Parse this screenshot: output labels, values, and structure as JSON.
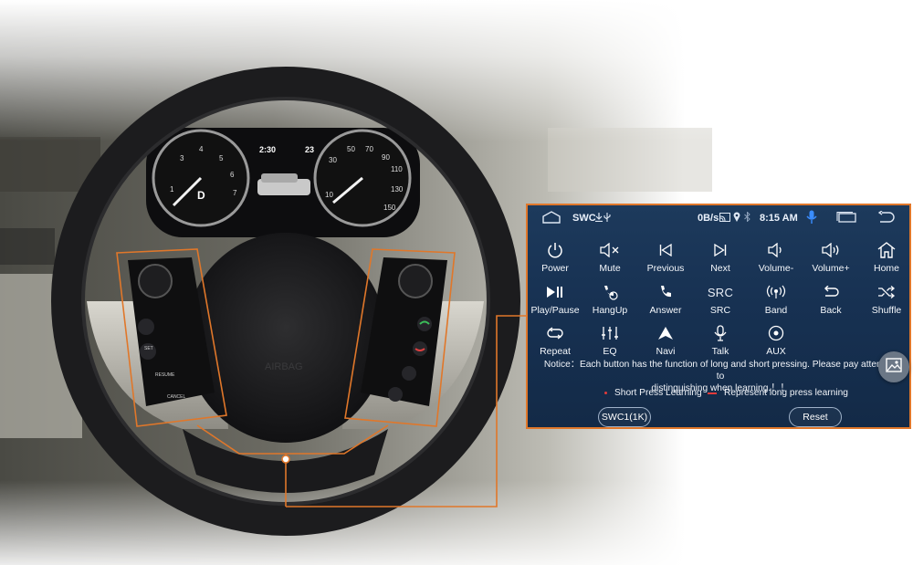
{
  "status_bar": {
    "app_name": "SWC",
    "net_speed": "0B/s",
    "time": "8:15 AM"
  },
  "buttons": [
    {
      "label": "Power",
      "icon": "power-icon"
    },
    {
      "label": "Mute",
      "icon": "mute-icon"
    },
    {
      "label": "Previous",
      "icon": "skip-previous-icon"
    },
    {
      "label": "Next",
      "icon": "skip-next-icon"
    },
    {
      "label": "Volume-",
      "icon": "volume-down-icon"
    },
    {
      "label": "Volume+",
      "icon": "volume-up-icon"
    },
    {
      "label": "Home",
      "icon": "home-icon"
    },
    {
      "label": "Play/Pause",
      "icon": "play-pause-icon"
    },
    {
      "label": "HangUp",
      "icon": "hang-up-icon"
    },
    {
      "label": "Answer",
      "icon": "phone-answer-icon"
    },
    {
      "label": "SRC",
      "icon": "src-text-icon",
      "icon_text": "SRC"
    },
    {
      "label": "Band",
      "icon": "radio-band-icon"
    },
    {
      "label": "Back",
      "icon": "back-arrow-icon"
    },
    {
      "label": "Shuffle",
      "icon": "shuffle-icon"
    },
    {
      "label": "Repeat",
      "icon": "repeat-icon"
    },
    {
      "label": "EQ",
      "icon": "equalizer-icon"
    },
    {
      "label": "Navi",
      "icon": "navigation-icon"
    },
    {
      "label": "Talk",
      "icon": "microphone-icon"
    },
    {
      "label": "AUX",
      "icon": "aux-icon"
    }
  ],
  "notice": {
    "line1": "Notice：Each button has the function of long and short pressing. Please pay attention to",
    "line2": "distinguishing when learning.！！"
  },
  "legend": {
    "short_press": "Short Press Learning",
    "long_press": "Represent long press learning",
    "mark_color": "#e23a3a"
  },
  "actions": {
    "swc_mode": "SWC1(1K)",
    "reset": "Reset"
  },
  "dashboard": {
    "clock": "2:30",
    "temperature": "23",
    "gear": "D"
  },
  "wheel_buttons": {
    "set": "SET",
    "resume": "RESUME",
    "cancel": "CANCEL",
    "airbag": "AIRBAG"
  },
  "colors": {
    "accent_orange": "#e0772a",
    "screen_bg": "#173152",
    "mic_blue": "#3a8dff"
  }
}
